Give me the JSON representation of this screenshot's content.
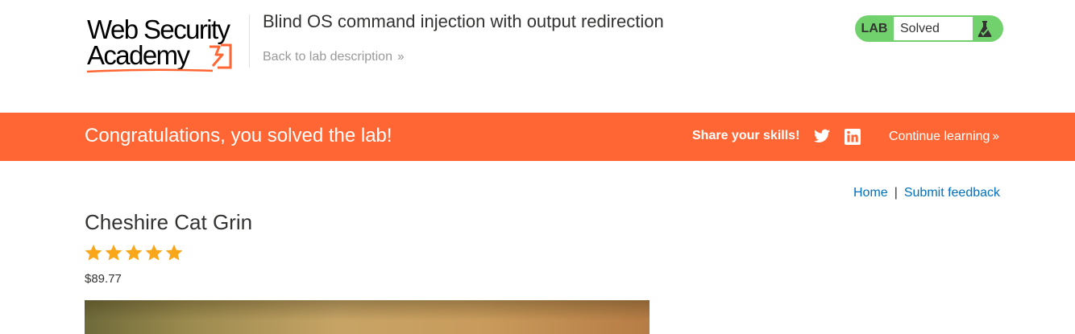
{
  "header": {
    "logo_line1": "Web Security",
    "logo_line2": "Academy",
    "lab_title": "Blind OS command injection with output redirection",
    "back_link": "Back to lab description",
    "lab_badge": "LAB",
    "lab_status": "Solved"
  },
  "banner": {
    "message": "Congratulations, you solved the lab!",
    "share_label": "Share your skills!",
    "continue_label": "Continue learning"
  },
  "nav": {
    "home": "Home",
    "separator": "|",
    "feedback": "Submit feedback"
  },
  "product": {
    "title": "Cheshire Cat Grin",
    "rating": 5,
    "rating_max": 5,
    "price": "$89.77"
  },
  "colors": {
    "brand_orange": "#ff6633",
    "lab_green": "#70d16d",
    "link_blue": "#0071bc",
    "star_gold": "#f9a61a"
  },
  "icons": [
    "chevron-double-right-icon",
    "flask-icon",
    "twitter-icon",
    "linkedin-icon",
    "star-icon"
  ]
}
